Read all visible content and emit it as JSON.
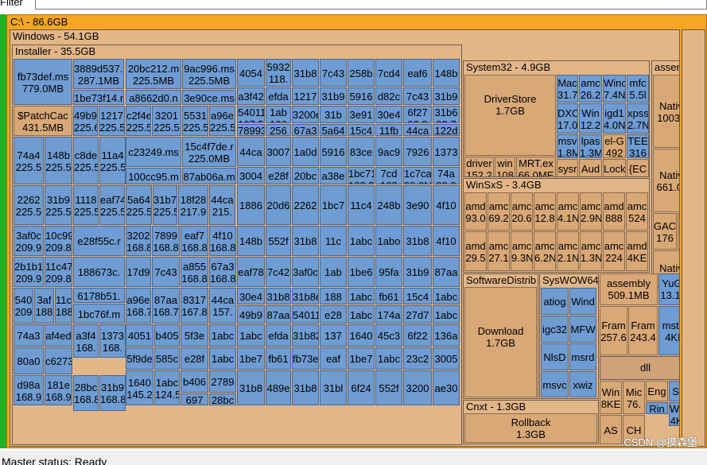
{
  "filter": {
    "label": "Filter",
    "value": ""
  },
  "root": {
    "label": "C:\\ - 86.6GB"
  },
  "windows": {
    "label": "Windows - 54.1GB"
  },
  "installer": {
    "label": "Installer - 35.5GB"
  },
  "system32": {
    "label": "System32 - 4.9GB"
  },
  "driverstore": {
    "name": "DriverStore",
    "size": "1.7GB"
  },
  "assembly_top": {
    "label": "assembly"
  },
  "winsxs": {
    "label": "WinSxS - 3.4GB"
  },
  "softdist": {
    "label": "SoftwareDistrib"
  },
  "download": {
    "name": "Download",
    "size": "1.7GB"
  },
  "syswow": {
    "label": "SysWOW64"
  },
  "assembly2": {
    "name": "assembly",
    "size": "509.1MB"
  },
  "yugo": {
    "name": "YuGo",
    "size": "13.1M"
  },
  "csxt": {
    "label": "Cnxt - 1.3GB"
  },
  "rollback": {
    "name": "Rollback",
    "size": "1.3GB"
  },
  "dll": {
    "label": "dll"
  },
  "patchcache": {
    "name": "$PatchCac",
    "size": "431.5MB"
  },
  "status": {
    "text": "Master status: Ready"
  },
  "watermark": {
    "text": "CSDN @摸森堡"
  },
  "installer_leaves": [
    [
      "fb73def.ms",
      "779.0MB"
    ],
    [
      "3889d537.i",
      "287.1MB"
    ],
    [
      "20bc212.m",
      "225.5MB"
    ],
    [
      "9ac996.ms",
      "225.5MB"
    ],
    [
      "1be73f14.n",
      ""
    ],
    [
      "a8662d0.n",
      ""
    ],
    [
      "3e90ce.ms",
      ""
    ],
    [
      "49b9",
      "225.6"
    ],
    [
      "1217",
      "225.5"
    ],
    [
      "c2f4e",
      "225.5"
    ],
    [
      "3201",
      "225.5"
    ],
    [
      "5531",
      "225.5"
    ],
    [
      "a96e",
      "225.5"
    ],
    [
      "74a4",
      "225.5"
    ],
    [
      "148b",
      "225.5"
    ],
    [
      "c8de",
      "225.5"
    ],
    [
      "11a4",
      "225.5"
    ],
    [
      "c23249.ms",
      ""
    ],
    [
      "15c4f7de.r",
      "225.0MB"
    ],
    [
      "100cc95.m",
      ""
    ],
    [
      "87ab06a.m",
      ""
    ],
    [
      "2262",
      "225.5"
    ],
    [
      "31b9",
      "225.5"
    ],
    [
      "1118",
      "225.5"
    ],
    [
      "eaf74",
      "225.5"
    ],
    [
      "5a64",
      "225.5"
    ],
    [
      "31b7",
      "225.5"
    ],
    [
      "18f28",
      "217.9"
    ],
    [
      "44ca",
      "215."
    ],
    [
      "3af0c",
      "209.9"
    ],
    [
      "10c99",
      "209.8"
    ],
    [
      "e28f55c.r",
      ""
    ],
    [
      "3202",
      "168.8"
    ],
    [
      "7899",
      "168.8"
    ],
    [
      "eaf7",
      "168.8"
    ],
    [
      "4f10",
      "168.8"
    ],
    [
      "2b1b1",
      "209.9"
    ],
    [
      "11c47",
      "209.8"
    ],
    [
      "188673c.",
      ""
    ],
    [
      "17d9",
      ""
    ],
    [
      "7c43",
      ""
    ],
    [
      "a855",
      "168.8"
    ],
    [
      "67a3",
      "168.8"
    ],
    [
      "6178b51.",
      ""
    ],
    [
      "540",
      "209"
    ],
    [
      "3af",
      "188"
    ],
    [
      "11c",
      "188"
    ],
    [
      "1bc76f.m",
      ""
    ],
    [
      "a96e",
      "168.7"
    ],
    [
      "87aa",
      "168.7"
    ],
    [
      "8317",
      "167.8"
    ],
    [
      "44ca",
      "157."
    ],
    [
      "74a3",
      ""
    ],
    [
      "af4ed",
      ""
    ],
    [
      "a3f4",
      "168."
    ],
    [
      "1373",
      "168."
    ],
    [
      "4051",
      ""
    ],
    [
      "b405",
      ""
    ],
    [
      "5f3e",
      ""
    ],
    [
      "1abc",
      ""
    ],
    [
      "80a0",
      ""
    ],
    [
      "c6273",
      ""
    ],
    [
      "5f9de",
      ""
    ],
    [
      "585c",
      ""
    ],
    [
      "e28f",
      ""
    ],
    [
      "1abc",
      ""
    ],
    [
      "d98a",
      "168.9"
    ],
    [
      "181e",
      "168.9"
    ],
    [
      "28bc",
      "168.8"
    ],
    [
      "31b9",
      "168.8"
    ],
    [
      "1640",
      "145.2"
    ],
    [
      "1abc",
      "124.5"
    ],
    [
      "b406",
      ""
    ],
    [
      "2789",
      ""
    ],
    [
      "697",
      ""
    ],
    [
      "28bc",
      ""
    ]
  ],
  "mid_leaves": [
    [
      "4054",
      ""
    ],
    [
      "5932",
      "118."
    ],
    [
      "31b8",
      ""
    ],
    [
      "7c43",
      ""
    ],
    [
      "258b",
      ""
    ],
    [
      "7cd4",
      ""
    ],
    [
      "eaf6",
      ""
    ],
    [
      "148b",
      ""
    ],
    [
      "a3f42",
      ""
    ],
    [
      "efda",
      ""
    ],
    [
      "1217",
      ""
    ],
    [
      "31b9",
      ""
    ],
    [
      "5916",
      ""
    ],
    [
      "d82c",
      ""
    ],
    [
      "7c43",
      ""
    ],
    [
      "31b9",
      ""
    ],
    [
      "54011",
      "107.5"
    ],
    [
      "1ab",
      "106"
    ],
    [
      "3200e",
      ""
    ],
    [
      "31b",
      ""
    ],
    [
      "3e91",
      ""
    ],
    [
      "30e4",
      ""
    ],
    [
      "6f27",
      "98.8"
    ],
    [
      "31b6",
      "98.7"
    ],
    [
      "78993",
      ""
    ],
    [
      "256",
      ""
    ],
    [
      "67a3",
      ""
    ],
    [
      "5a64",
      ""
    ],
    [
      "15c4",
      ""
    ],
    [
      "11fb",
      ""
    ],
    [
      "44ca",
      ""
    ],
    [
      "122d",
      ""
    ],
    [
      "44ca",
      ""
    ],
    [
      "3007",
      ""
    ],
    [
      "1a0d",
      ""
    ],
    [
      "5916",
      ""
    ],
    [
      "83ce",
      ""
    ],
    [
      "9ac9",
      ""
    ],
    [
      "7926",
      ""
    ],
    [
      "1373",
      ""
    ],
    [
      "3004",
      ""
    ],
    [
      "e28f",
      ""
    ],
    [
      "20bc",
      ""
    ],
    [
      "a38e",
      ""
    ],
    [
      "1bc71",
      "103.9"
    ],
    [
      "7cd",
      "103"
    ],
    [
      "1c7ca",
      "99.0M"
    ],
    [
      "74a",
      "99.0"
    ],
    [
      "1886",
      ""
    ],
    [
      "20d6",
      ""
    ],
    [
      "2262",
      ""
    ],
    [
      "1bc7",
      ""
    ],
    [
      "11c4",
      ""
    ],
    [
      "248b",
      ""
    ],
    [
      "3e90",
      ""
    ],
    [
      "4f10",
      ""
    ],
    [
      "148b",
      ""
    ],
    [
      "552f",
      ""
    ],
    [
      "31b8",
      ""
    ],
    [
      "11c",
      ""
    ],
    [
      "1abc",
      ""
    ],
    [
      "1abo",
      ""
    ],
    [
      "31b8",
      ""
    ],
    [
      "4f10",
      ""
    ],
    [
      "eaf78",
      ""
    ],
    [
      "7c42",
      ""
    ],
    [
      "3af0c",
      ""
    ],
    [
      "1ab",
      ""
    ],
    [
      "1be6",
      ""
    ],
    [
      "95fa",
      ""
    ],
    [
      "31b9",
      ""
    ],
    [
      "87aa",
      ""
    ],
    [
      "30e4",
      ""
    ],
    [
      "31b8",
      ""
    ],
    [
      "31b8e",
      ""
    ],
    [
      "188",
      ""
    ],
    [
      "1abc",
      ""
    ],
    [
      "fb61",
      ""
    ],
    [
      "15c4",
      ""
    ],
    [
      "1abc",
      ""
    ],
    [
      "49b9",
      ""
    ],
    [
      "87aa",
      ""
    ],
    [
      "54011",
      ""
    ],
    [
      "e28",
      ""
    ],
    [
      "1abc",
      ""
    ],
    [
      "174a",
      ""
    ],
    [
      "27d7",
      ""
    ],
    [
      "1abc",
      ""
    ],
    [
      "1abc",
      ""
    ],
    [
      "efda",
      ""
    ],
    [
      "31b82",
      ""
    ],
    [
      "137",
      ""
    ],
    [
      "1640",
      ""
    ],
    [
      "45c3",
      ""
    ],
    [
      "6f22",
      ""
    ],
    [
      "136a",
      ""
    ],
    [
      "1be7",
      ""
    ],
    [
      "fb61",
      ""
    ],
    [
      "fb73e",
      ""
    ],
    [
      "eaf",
      ""
    ],
    [
      "1be7",
      ""
    ],
    [
      "1abc",
      ""
    ],
    [
      "23c2",
      ""
    ],
    [
      "3005",
      ""
    ],
    [
      "31b8",
      ""
    ],
    [
      "489e",
      ""
    ],
    [
      "31b8",
      ""
    ],
    [
      "31bl",
      ""
    ],
    [
      "6f24",
      ""
    ],
    [
      "552f",
      ""
    ],
    [
      "3200",
      ""
    ],
    [
      "ae30",
      ""
    ],
    [
      "4d36",
      ""
    ],
    [
      "31b8",
      ""
    ],
    [
      "4d36",
      ""
    ],
    [
      "15c4",
      ""
    ],
    [
      "3889",
      ""
    ],
    [
      "1640",
      ""
    ],
    [
      "31b8",
      ""
    ],
    [
      "{E31",
      ""
    ]
  ],
  "s32_leaves": [
    [
      "Mac",
      "31.7"
    ],
    [
      "amc",
      "26.2"
    ],
    [
      "Winc",
      "7.4N"
    ],
    [
      "mfc",
      "5.5l"
    ],
    [
      "DXC",
      "17.0"
    ],
    [
      "Win",
      "12.2"
    ],
    [
      "igd1",
      "4.0N"
    ],
    [
      "xpss",
      "2.7N"
    ],
    [
      "msv",
      "1.8M"
    ],
    [
      "lpas",
      "1.3M"
    ],
    [
      "el-G",
      "492"
    ],
    [
      "TEE",
      "316"
    ],
    [
      "driver",
      "152.2"
    ],
    [
      "win",
      "108"
    ],
    [
      "MRT.ex",
      "66.0ME"
    ],
    [
      "sysr",
      ""
    ],
    [
      "Aud",
      ""
    ],
    [
      "Lock",
      ""
    ],
    [
      "{EC",
      ""
    ]
  ],
  "assembly_right": [
    [
      "NativeIr",
      "1003.3M"
    ],
    [
      "NativeIr",
      "661.0ME"
    ],
    [
      "GAC",
      "176"
    ],
    [
      "Nat",
      "173"
    ],
    [
      "NativeIr",
      ""
    ]
  ],
  "winsxs_leaves": [
    [
      "amd",
      "93.0"
    ],
    [
      "amc",
      "69.2"
    ],
    [
      "amc",
      "20.6"
    ],
    [
      "amc",
      "12.8"
    ],
    [
      "amc",
      "4.1N"
    ],
    [
      "amc",
      "2.9N"
    ],
    [
      "amd",
      "888"
    ],
    [
      "amc",
      "524"
    ],
    [
      "amd",
      "29.5"
    ],
    [
      "amc",
      "27.1"
    ],
    [
      "amc",
      "9.3N"
    ],
    [
      "amc",
      "6.2N"
    ],
    [
      "amc",
      "2.1N"
    ],
    [
      "amc",
      "1.3N"
    ],
    [
      "amc",
      "224"
    ],
    [
      "amd",
      "4KE"
    ]
  ],
  "syswow_leaves": [
    [
      "atiog",
      ""
    ],
    [
      "Wind",
      ""
    ],
    [
      "igc32",
      ""
    ],
    [
      "MFW",
      ""
    ],
    [
      "NlsD",
      ""
    ],
    [
      "msrd",
      ""
    ],
    [
      "msvc",
      ""
    ],
    [
      "xwiz",
      ""
    ]
  ],
  "small_right": [
    [
      "Fram",
      "257.6"
    ],
    [
      "Fram",
      "243.4"
    ],
    [
      "mstm",
      "4KB"
    ],
    [
      "Win",
      "8KE"
    ],
    [
      "Mic",
      "76."
    ],
    [
      "Eng",
      ""
    ],
    [
      "Sta",
      ""
    ],
    [
      "Rin",
      ""
    ],
    [
      "WinI",
      "4KB"
    ],
    [
      "AS",
      ""
    ],
    [
      "CH",
      ""
    ]
  ]
}
